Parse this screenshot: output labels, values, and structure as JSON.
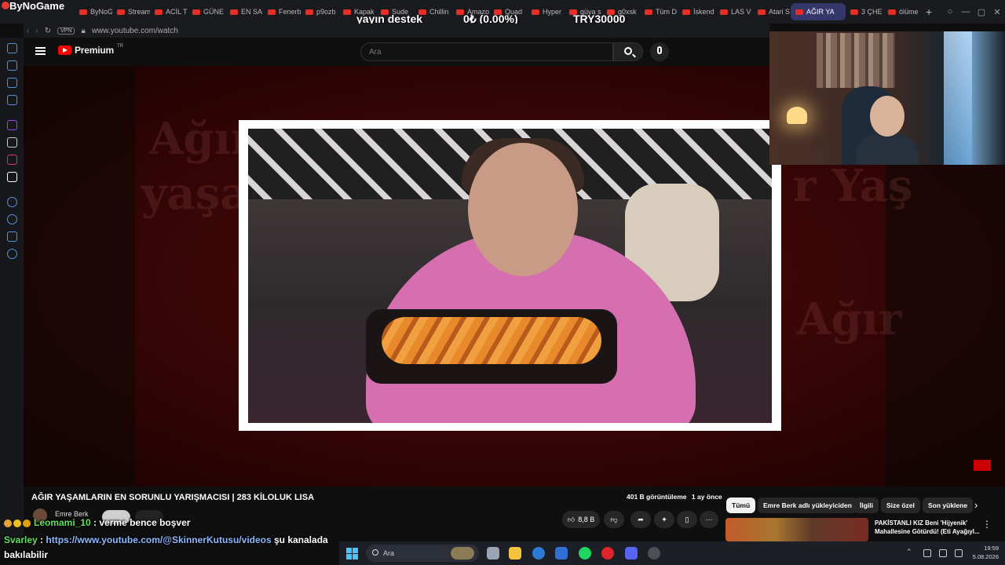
{
  "overlay": {
    "brand": "ByNoGame",
    "support_label": "yayın destek",
    "support_percent": "0₺ (0.00%)",
    "goal": "TRY30000"
  },
  "tabs": [
    {
      "label": "ByNoG"
    },
    {
      "label": "Stream"
    },
    {
      "label": "ACİL T"
    },
    {
      "label": "GÜNE"
    },
    {
      "label": "EN SA"
    },
    {
      "label": "Fenerb"
    },
    {
      "label": "p9ozb"
    },
    {
      "label": "Kapak"
    },
    {
      "label": "Sude"
    },
    {
      "label": "Chillin"
    },
    {
      "label": "Amazo"
    },
    {
      "label": "Quad"
    },
    {
      "label": "Hyper"
    },
    {
      "label": "güya s"
    },
    {
      "label": "g0xsk"
    },
    {
      "label": "Tüm D"
    },
    {
      "label": "İskend"
    },
    {
      "label": "LAS V"
    },
    {
      "label": "Atari S"
    },
    {
      "label": "AĞIR YA",
      "active": true
    },
    {
      "label": "3 ÇHE"
    },
    {
      "label": "ölüme"
    }
  ],
  "address": {
    "vpn": "VPN",
    "url": "www.youtube.com/watch"
  },
  "youtube": {
    "logo_text": "Premium",
    "logo_region": "TR",
    "search_placeholder": "Ara"
  },
  "player": {
    "bg_word_1": "Ağır",
    "bg_word_2": "yaşam",
    "bg_word_3": "r Yaş",
    "bg_word_4": "Ağır"
  },
  "video": {
    "title": "AĞIR YAŞAMLARIN EN SORUNLU YARIŞMACISI | 283 KİLOLUK LISA",
    "views": "401 B görüntüleme",
    "age": "1 ay önce",
    "channel": "Emre Berk",
    "likes": "8,8 B"
  },
  "chips": [
    "Tümü",
    "Emre Berk adlı yükleyiciden",
    "İlgili",
    "Size özel",
    "Son yüklene"
  ],
  "recommendation": {
    "title": "PAKİSTANLI KIZ Beni 'Hijyenik' Mahallesine Götürdü! (Eti Ayağıyl..."
  },
  "chat": [
    {
      "user": "Leomami_10",
      "sep": " : ",
      "message": "verme bence boşver"
    },
    {
      "user": "Svarley",
      "sep": " : ",
      "link": "https://www.youtube.com/@SkinnerKutusu/videos",
      "message": " şu kanalada",
      "message2": "bakılabilir"
    }
  ],
  "taskbar": {
    "search_placeholder": "Ara",
    "time": "19:59",
    "date": "5.08.2026"
  },
  "colors": {
    "youtube_red": "#ff0000",
    "chat_user": "#5fe15f",
    "chat_link": "#8fb8ff",
    "tab_active": "#35376b"
  }
}
